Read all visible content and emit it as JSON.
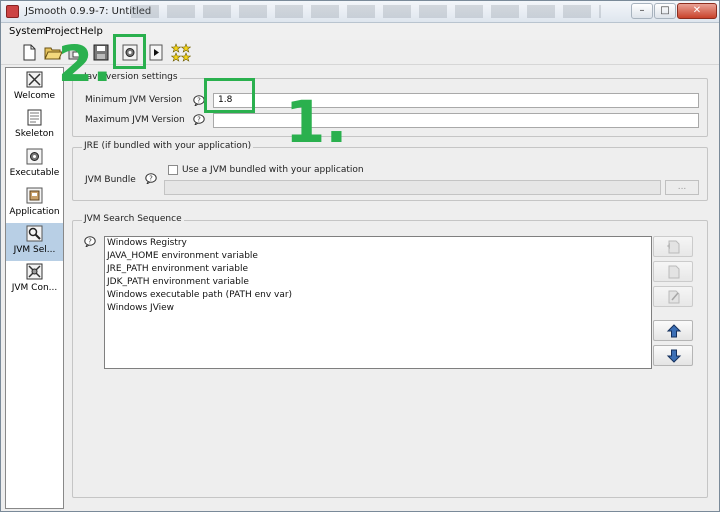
{
  "window": {
    "title": "JSmooth 0.9.9-7: Untitled",
    "buttons": [
      "–",
      "□",
      "✕"
    ]
  },
  "menu": [
    "System",
    "Project",
    "Help"
  ],
  "toolbar": [
    "new-file",
    "open-folder",
    "open-project",
    "save",
    "compile",
    "run",
    "about"
  ],
  "sidebar": {
    "items": [
      {
        "label": "Welcome",
        "icon": "welcome-icon"
      },
      {
        "label": "Skeleton",
        "icon": "skeleton-icon"
      },
      {
        "label": "Executable",
        "icon": "executable-icon"
      },
      {
        "label": "Application",
        "icon": "application-icon"
      },
      {
        "label": "JVM Sel...",
        "icon": "jvm-select-icon",
        "selected": true
      },
      {
        "label": "JVM Con...",
        "icon": "jvm-config-icon"
      }
    ]
  },
  "java_version": {
    "legend": "Java version settings",
    "min_label": "Minimum JVM Version",
    "min_value": "1.8",
    "max_label": "Maximum JVM Version",
    "max_value": ""
  },
  "jre": {
    "legend": "JRE (if bundled with your application)",
    "bundle_label": "JVM Bundle",
    "checkbox_label": "Use a JVM bundled with your application",
    "path_value": "",
    "browse_label": "..."
  },
  "search": {
    "legend": "JVM Search Sequence",
    "items": [
      "Windows Registry",
      "JAVA_HOME environment variable",
      "JRE_PATH environment variable",
      "JDK_PATH environment variable",
      "Windows executable path (PATH env var)",
      "Windows JView"
    ]
  },
  "annotations": {
    "step1": "1.",
    "step2": "2."
  },
  "colors": {
    "annotation": "#2ab04e",
    "selection": "#b8cfe5"
  }
}
